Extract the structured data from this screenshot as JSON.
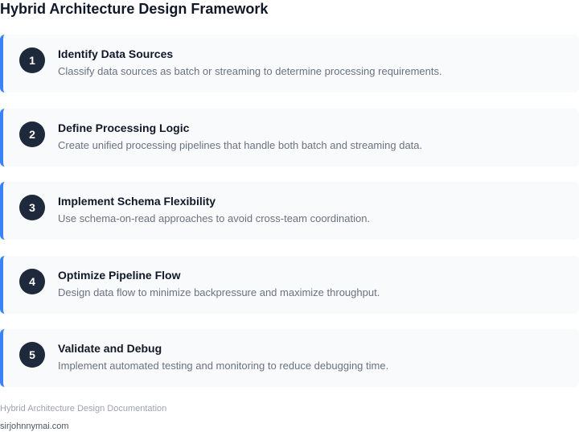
{
  "title": "Hybrid Architecture Design Framework",
  "steps": [
    {
      "number": "1",
      "title": "Identify Data Sources",
      "description": "Classify data sources as batch or streaming to determine processing requirements."
    },
    {
      "number": "2",
      "title": "Define Processing Logic",
      "description": "Create unified processing pipelines that handle both batch and streaming data."
    },
    {
      "number": "3",
      "title": "Implement Schema Flexibility",
      "description": "Use schema-on-read approaches to avoid cross-team coordination."
    },
    {
      "number": "4",
      "title": "Optimize Pipeline Flow",
      "description": "Design data flow to minimize backpressure and maximize throughput."
    },
    {
      "number": "5",
      "title": "Validate and Debug",
      "description": "Implement automated testing and monitoring to reduce debugging time."
    }
  ],
  "footer": {
    "documentation": "Hybrid Architecture Design Documentation",
    "site": "sirjohnnymai.com"
  },
  "colors": {
    "accent": "#3b82f6",
    "badge": "#1e293b",
    "card_background": "#f8fafc"
  }
}
